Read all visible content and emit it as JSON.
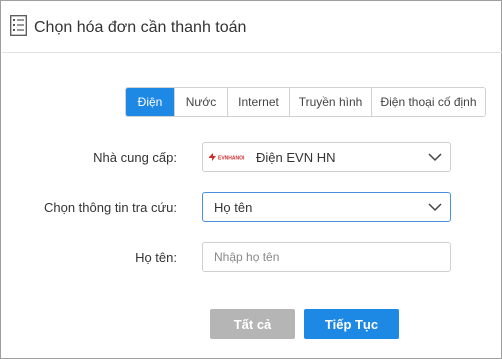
{
  "header": {
    "title": "Chọn hóa đơn cần thanh toán",
    "icon": "checklist-icon"
  },
  "tabs": [
    {
      "label": "Điện",
      "active": true
    },
    {
      "label": "Nước",
      "active": false
    },
    {
      "label": "Internet",
      "active": false
    },
    {
      "label": "Truyền hình",
      "active": false
    },
    {
      "label": "Điện thoại cố định",
      "active": false
    }
  ],
  "form": {
    "provider_label": "Nhà cung cấp:",
    "provider_value": "Điện EVN HN",
    "provider_logo_text": "EVNHANOI",
    "lookup_label": "Chọn thông tin tra cứu:",
    "lookup_value": "Họ tên",
    "name_label": "Họ tên:",
    "name_placeholder": "Nhập họ tên",
    "name_value": ""
  },
  "buttons": {
    "clear_label": "Tất cả",
    "next_label": "Tiếp Tục"
  },
  "colors": {
    "accent": "#1e88e5",
    "disabled": "#b5b5b5",
    "focus_border": "#4a90e2"
  }
}
